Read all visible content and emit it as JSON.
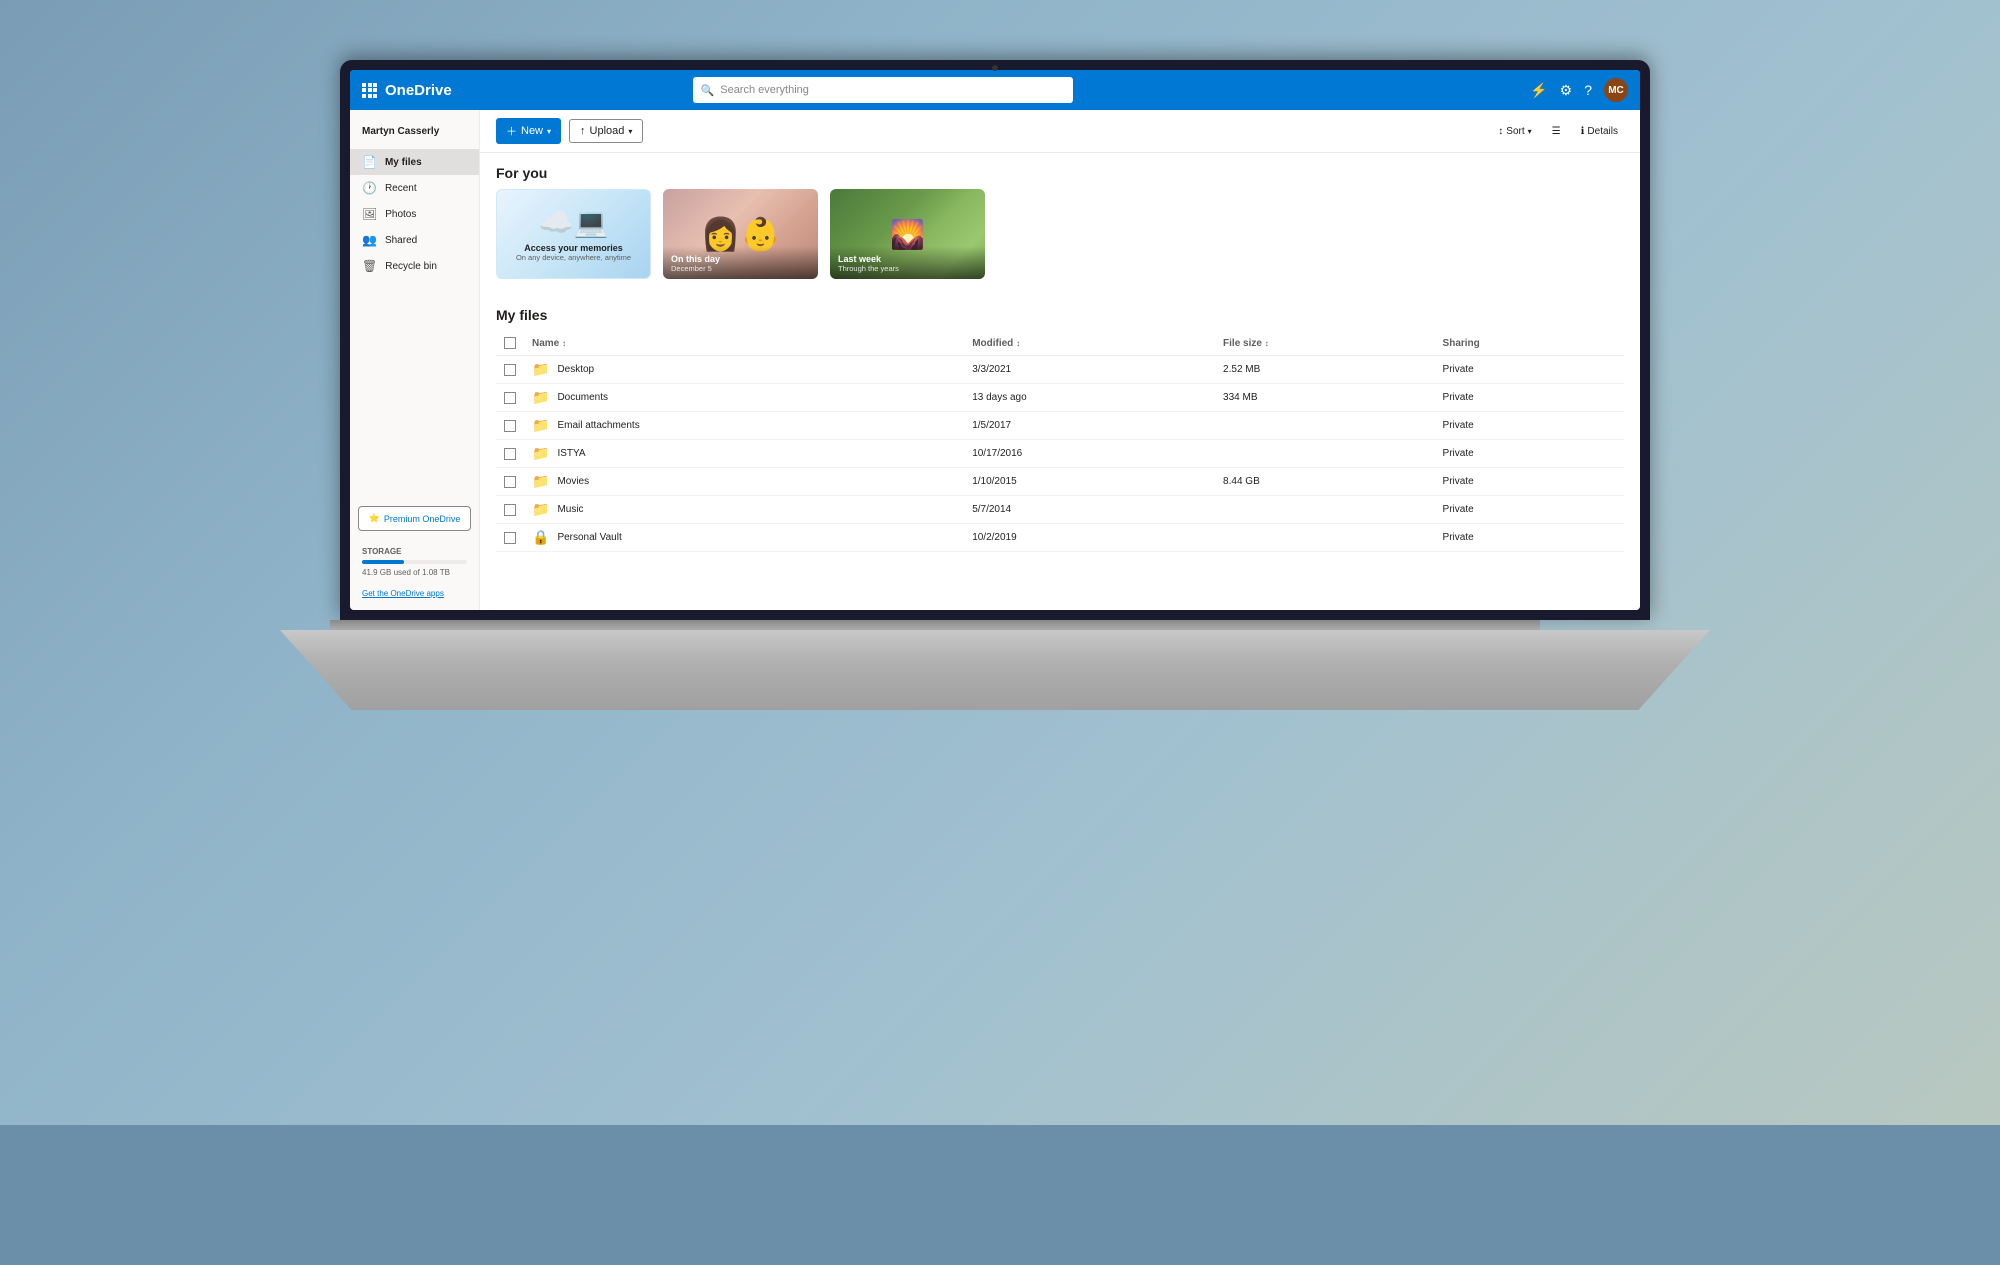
{
  "brand": {
    "name": "OneDrive",
    "logo": "waffle"
  },
  "topbar": {
    "search_placeholder": "Search everything",
    "icons": [
      "lightning-icon",
      "settings-icon",
      "help-icon"
    ],
    "avatar_initials": "MC"
  },
  "sidebar": {
    "user_name": "Martyn Casserly",
    "nav_items": [
      {
        "id": "my-files",
        "label": "My files",
        "icon": "📄",
        "active": true
      },
      {
        "id": "recent",
        "label": "Recent",
        "icon": "🕐",
        "active": false
      },
      {
        "id": "photos",
        "label": "Photos",
        "icon": "🖼",
        "active": false
      },
      {
        "id": "shared",
        "label": "Shared",
        "icon": "👥",
        "active": false
      },
      {
        "id": "recycle-bin",
        "label": "Recycle bin",
        "icon": "🗑",
        "active": false
      }
    ],
    "premium_btn": "Premium OneDrive",
    "storage": {
      "label": "STORAGE",
      "used": "41.9 GB used of 1.08 TB",
      "fill_percent": 40
    },
    "get_apps": "Get the OneDrive apps"
  },
  "toolbar": {
    "new_label": "New",
    "upload_label": "Upload",
    "sort_label": "Sort",
    "view_label": "",
    "details_label": "Details"
  },
  "for_you": {
    "section_title": "For you",
    "cards": [
      {
        "id": "access-memories",
        "type": "promo",
        "title": "Access your memories",
        "subtitle": "On any device, anywhere, anytime"
      },
      {
        "id": "on-this-day",
        "type": "photo",
        "label": "On this day",
        "sublabel": "December 5"
      },
      {
        "id": "last-week",
        "type": "photo",
        "label": "Last week",
        "sublabel": "Through the years"
      }
    ]
  },
  "my_files": {
    "section_title": "My files",
    "columns": {
      "name": "Name",
      "modified": "Modified",
      "file_size": "File size",
      "sharing": "Sharing"
    },
    "rows": [
      {
        "icon": "folder",
        "name": "Desktop",
        "modified": "3/3/2021",
        "size": "2.52 MB",
        "sharing": "Private"
      },
      {
        "icon": "folder",
        "name": "Documents",
        "modified": "13 days ago",
        "size": "334 MB",
        "sharing": "Private"
      },
      {
        "icon": "folder",
        "name": "Email attachments",
        "modified": "1/5/2017",
        "size": "",
        "sharing": "Private"
      },
      {
        "icon": "folder",
        "name": "ISTYA",
        "modified": "10/17/2016",
        "size": "",
        "sharing": "Private"
      },
      {
        "icon": "folder",
        "name": "Movies",
        "modified": "1/10/2015",
        "size": "8.44 GB",
        "sharing": "Private"
      },
      {
        "icon": "folder",
        "name": "Music",
        "modified": "5/7/2014",
        "size": "",
        "sharing": "Private"
      },
      {
        "icon": "vault",
        "name": "Personal Vault",
        "modified": "10/2/2019",
        "size": "",
        "sharing": "Private"
      }
    ]
  }
}
